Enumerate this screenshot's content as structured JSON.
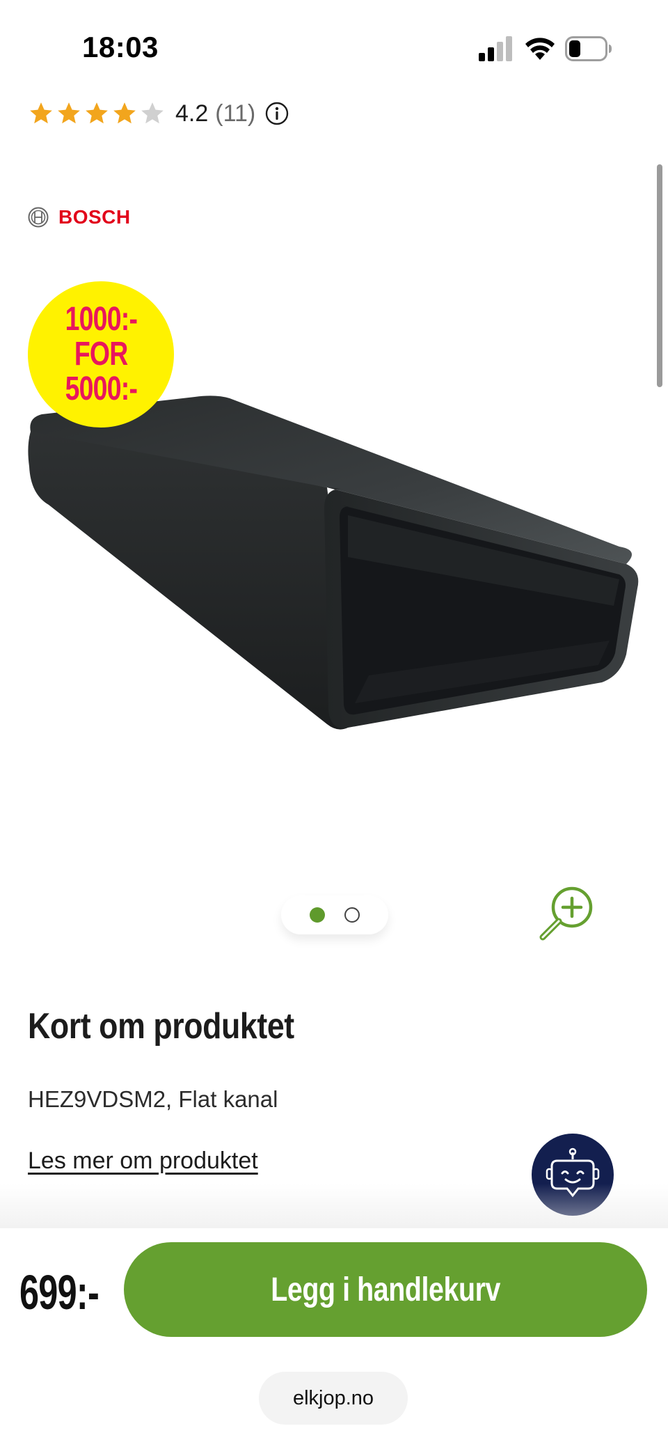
{
  "status_bar": {
    "time": "18:03"
  },
  "rating": {
    "value": "4.2",
    "count": "(11)",
    "stars_filled": 4,
    "stars_total": 5
  },
  "brand": {
    "name": "BOSCH"
  },
  "promo": {
    "line1": "1000:-",
    "line2": "FOR",
    "line3": "5000:-"
  },
  "carousel": {
    "active_index": 0,
    "total": 2
  },
  "product": {
    "section_title": "Kort om produktet",
    "subtitle": "HEZ9VDSM2, Flat kanal",
    "read_more": "Les mer om produktet"
  },
  "purchase": {
    "price": "699:-",
    "cart_button": "Legg i handlekurv"
  },
  "browser": {
    "url": "elkjop.no"
  },
  "colors": {
    "accent_green": "#65a030",
    "brand_red": "#e2001a",
    "star": "#f2a51d",
    "promo_yellow": "#fff200",
    "promo_pink": "#e8175d",
    "chatbot_navy": "#131f4f"
  },
  "icons": {
    "rating_info": "info-icon",
    "zoom": "zoom-in-icon",
    "chatbot": "robot-chat-icon"
  }
}
